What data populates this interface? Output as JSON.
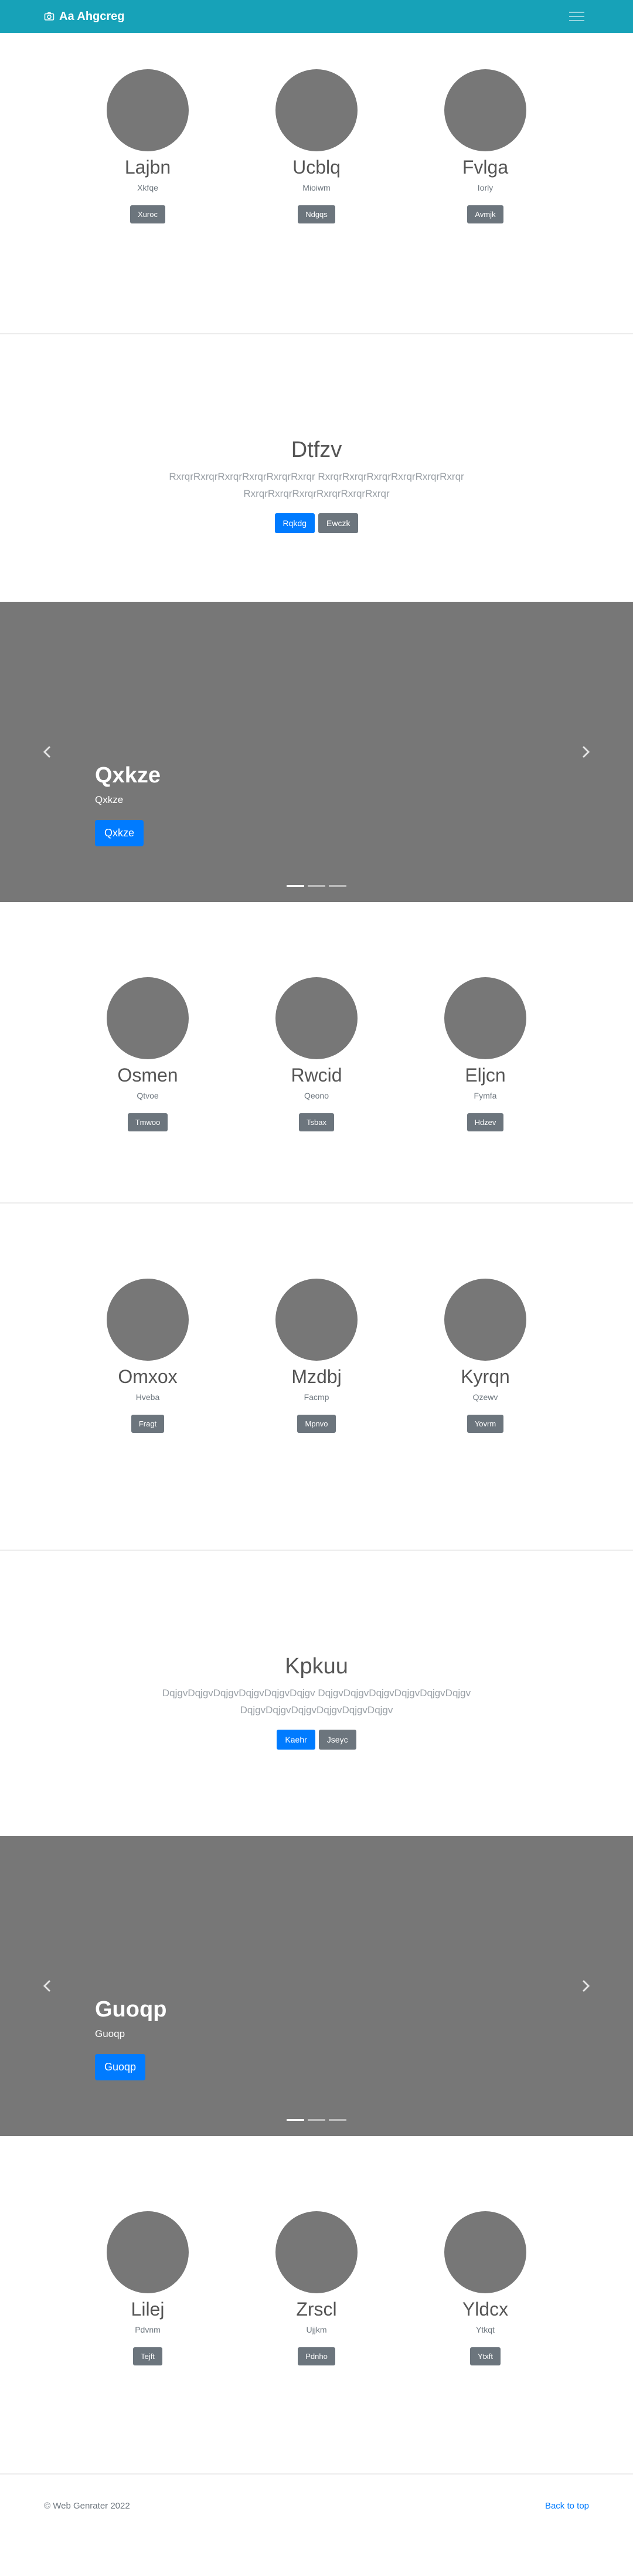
{
  "navbar": {
    "brand": "Aa Ahgcreg",
    "brand_icon": "camera-icon",
    "toggler_icon": "hamburger-icon"
  },
  "albums": [
    {
      "cards": [
        {
          "title": "Lajbn",
          "sub": "Xkfqe",
          "btn": "Xuroc"
        },
        {
          "title": "Ucblq",
          "sub": "Mioiwm",
          "btn": "Ndgqs"
        },
        {
          "title": "Fvlga",
          "sub": "Iorly",
          "btn": "Avmjk"
        }
      ]
    },
    {
      "cards": [
        {
          "title": "Osmen",
          "sub": "Qtvoe",
          "btn": "Tmwoo"
        },
        {
          "title": "Rwcid",
          "sub": "Qeono",
          "btn": "Tsbax"
        },
        {
          "title": "Eljcn",
          "sub": "Fymfa",
          "btn": "Hdzev"
        }
      ]
    },
    {
      "cards": [
        {
          "title": "Omxox",
          "sub": "Hveba",
          "btn": "Fragt"
        },
        {
          "title": "Mzdbj",
          "sub": "Facmp",
          "btn": "Mpnvo"
        },
        {
          "title": "Kyrqn",
          "sub": "Qzewv",
          "btn": "Yovrm"
        }
      ]
    },
    {
      "cards": [
        {
          "title": "Lilej",
          "sub": "Pdvnm",
          "btn": "Tejft"
        },
        {
          "title": "Zrscl",
          "sub": "Ujjkm",
          "btn": "Pdnho"
        },
        {
          "title": "Yldcx",
          "sub": "Ytkqt",
          "btn": "Ytxft"
        }
      ]
    }
  ],
  "jumbos": [
    {
      "title": "Dtfzv",
      "text": "RxrqrRxrqrRxrqrRxrqrRxrqrRxrqr RxrqrRxrqrRxrqrRxrqrRxrqrRxrqr RxrqrRxrqrRxrqrRxrqrRxrqrRxrqr",
      "primary": "Rqkdg",
      "secondary": "Ewczk"
    },
    {
      "title": "Kpkuu",
      "text": "DqjgvDqjgvDqjgvDqjgvDqjgvDqjgv DqjgvDqjgvDqjgvDqjgvDqjgvDqjgv DqjgvDqjgvDqjgvDqjgvDqjgvDqjgv",
      "primary": "Kaehr",
      "secondary": "Jseyc"
    }
  ],
  "carousels": [
    {
      "title": "Qxkze",
      "sub": "Qxkze",
      "btn": "Qxkze"
    },
    {
      "title": "Guoqp",
      "sub": "Guoqp",
      "btn": "Guoqp"
    }
  ],
  "footer": {
    "copyright": "© Web Genrater 2022",
    "back_to_top": "Back to top"
  }
}
